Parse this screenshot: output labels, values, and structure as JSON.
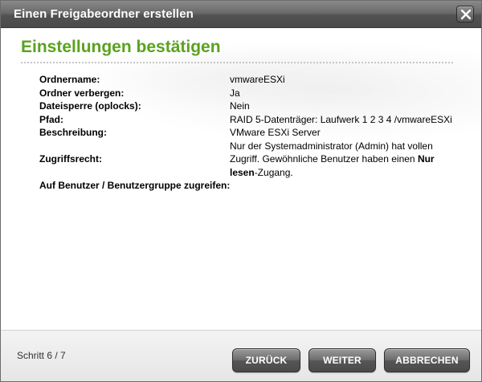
{
  "window": {
    "title": "Einen Freigabeordner erstellen",
    "close_icon": "close-icon"
  },
  "main": {
    "heading": "Einstellungen bestätigen",
    "rows": {
      "folder_name": {
        "label": "Ordnername:",
        "value": "vmwareESXi"
      },
      "hide_folder": {
        "label": "Ordner verbergen:",
        "value": "Ja"
      },
      "oplocks": {
        "label": "Dateisperre (oplocks):",
        "value": "Nein"
      },
      "path": {
        "label": "Pfad:",
        "value": "RAID 5-Datenträger: Laufwerk 1 2 3 4 /vmwareESXi"
      },
      "description": {
        "label": "Beschreibung:",
        "value": "VMware ESXi Server"
      },
      "access": {
        "label": "Zugriffsrecht:",
        "value_part1": "Nur der Systemadministrator (Admin) hat vollen Zugriff. Gewöhnliche Benutzer haben einen ",
        "value_bold": "Nur lesen",
        "value_part2": "-Zugang."
      },
      "user_access": {
        "label": "Auf Benutzer / Benutzergruppe zugreifen:",
        "value": ""
      }
    }
  },
  "footer": {
    "step": "Schritt 6 / 7",
    "back_label": "ZURÜCK",
    "next_label": "WEITER",
    "cancel_label": "ABBRECHEN"
  },
  "colors": {
    "heading_green": "#5aa21f",
    "titlebar": "#5a5a5a"
  }
}
